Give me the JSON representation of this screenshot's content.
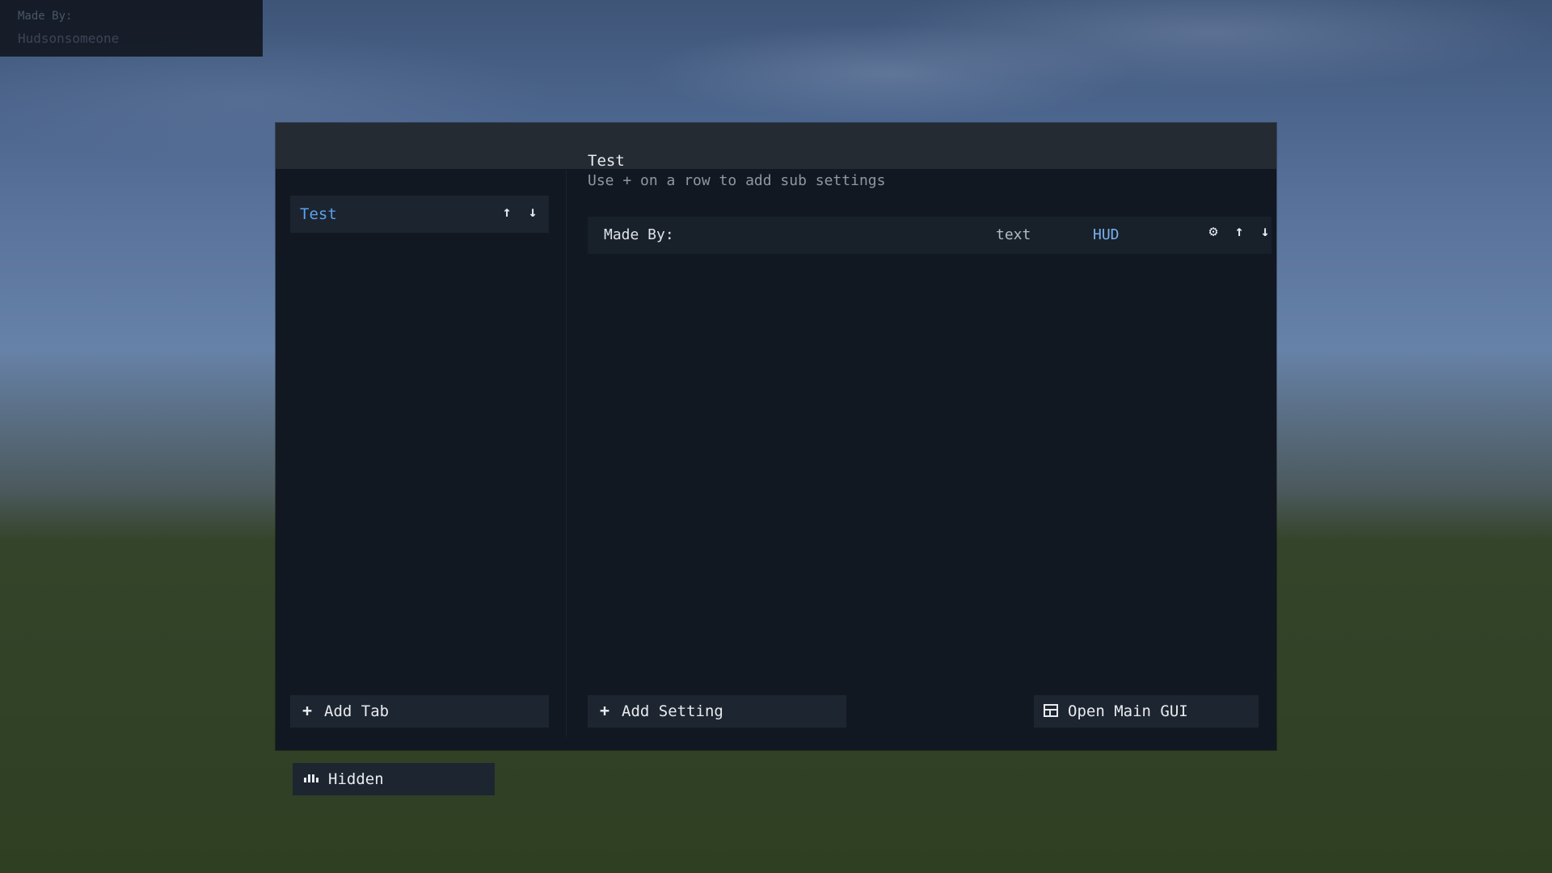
{
  "hud_overlay": {
    "line1": "Made By:",
    "line2": "Hudsonsomeone"
  },
  "sidebar": {
    "tabs": [
      {
        "label": "Test",
        "selected": true
      }
    ],
    "add_tab_label": "Add Tab"
  },
  "main": {
    "title": "Test",
    "hint": "Use + on a row to add sub settings",
    "rows": [
      {
        "name": "Made By:",
        "type": "text",
        "mode": "HUD"
      }
    ],
    "add_setting_label": "Add Setting",
    "open_main_label": "Open Main GUI"
  },
  "footer": {
    "hidden_label": "Hidden"
  },
  "icons": {
    "tab_up": "arrow-up-icon",
    "tab_down": "arrow-down-icon",
    "row_settings": "gear-icon",
    "row_up": "arrow-up-icon",
    "row_down": "arrow-down-icon",
    "add": "plus-icon",
    "open_main": "window-icon",
    "hidden": "eye-closed-icon"
  },
  "colors": {
    "accent": "#5aa2ea",
    "hud_mode": "#79b0ee",
    "panel": "#121821",
    "titlebar": "#252b33"
  }
}
